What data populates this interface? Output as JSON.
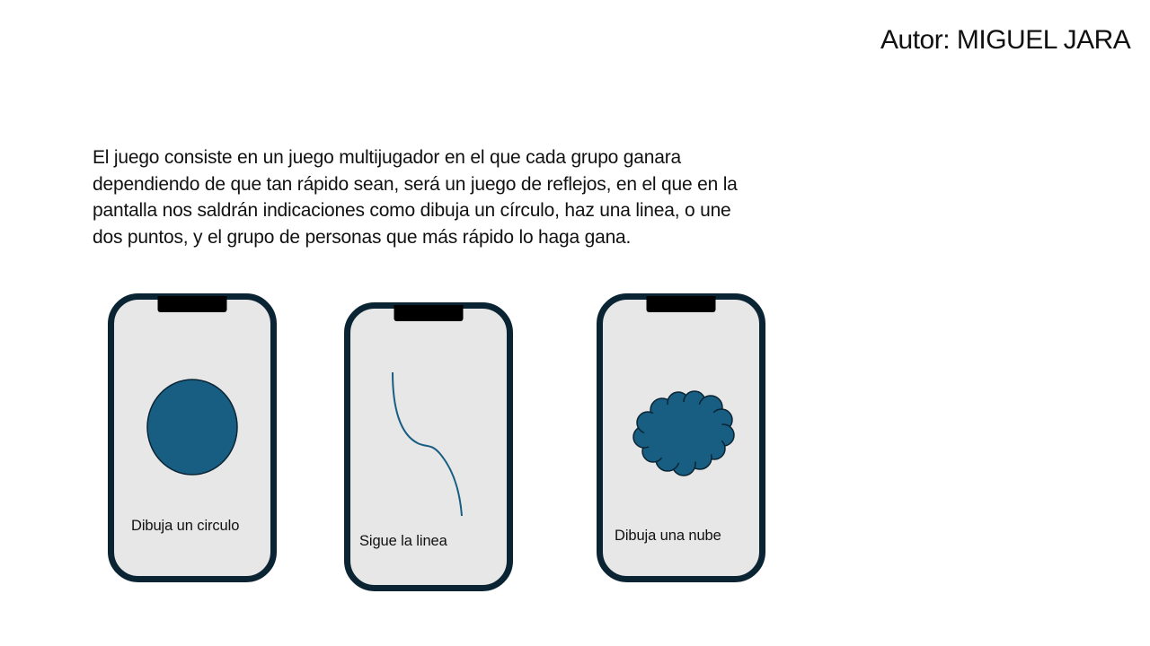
{
  "author": "Autor: MIGUEL JARA",
  "description": {
    "lines": [
      "El juego consiste en un juego multijugador en el que cada grupo ganara",
      "dependiendo de que tan rápido sean, será un juego de reflejos, en el que en la",
      "pantalla nos saldrán indicaciones como dibuja un círculo, haz una linea, o une",
      "dos puntos, y el grupo de personas que más rápido lo haga gana."
    ]
  },
  "phones": [
    {
      "caption": "Dibuja un circulo",
      "shape": "circle"
    },
    {
      "caption": "Sigue la linea",
      "shape": "line"
    },
    {
      "caption": "Dibuja una nube",
      "shape": "cloud"
    }
  ],
  "colors": {
    "phone_frame": "#0a2433",
    "phone_screen": "#e7e7e7",
    "shape_fill": "#175e82",
    "notch": "#000000"
  }
}
